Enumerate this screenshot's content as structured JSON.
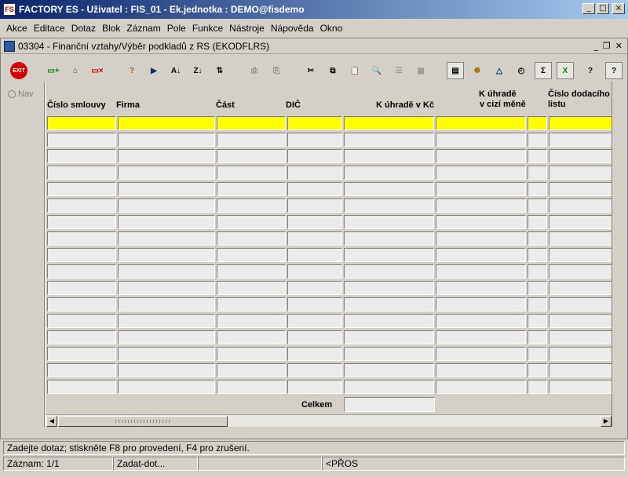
{
  "window": {
    "title": "FACTORY ES - Uživatel : FIS_01 - Ek.jednotka : DEMO@fisdemo",
    "app_icon": "FS"
  },
  "menu": [
    "Akce",
    "Editace",
    "Dotaz",
    "Blok",
    "Záznam",
    "Pole",
    "Funkce",
    "Nástroje",
    "Nápověda",
    "Okno"
  ],
  "form": {
    "title": "03304 - Finanční vztahy/Výběr podkladů z RS (EKODFLRS)"
  },
  "toolbar": {
    "exit_label": "EXIT",
    "icons": [
      "exit-icon",
      "insert-record-icon",
      "save-icon",
      "delete-record-icon",
      "query-icon",
      "execute-query-icon",
      "sort-asc-icon",
      "sort-desc-icon",
      "sort-icon",
      "print-icon",
      "print-preview-icon",
      "cut-icon",
      "copy-icon",
      "paste-icon",
      "zoom-icon",
      "list-icon",
      "grid-icon",
      "calculator-icon",
      "wheel-icon",
      "triangle-icon",
      "clock-icon",
      "sum-icon",
      "excel-icon",
      "help-icon",
      "context-help-icon"
    ]
  },
  "nav": {
    "label": "Nav"
  },
  "columns": [
    {
      "label": "Číslo smlouvy"
    },
    {
      "label": "Firma"
    },
    {
      "label": "Část"
    },
    {
      "label": "DIČ"
    },
    {
      "label": "K úhradě v Kč"
    },
    {
      "label_line1": "K úhradě",
      "label_line2": "v cizí měně"
    },
    {
      "label": ""
    },
    {
      "label_line1": "Číslo dodacího",
      "label_line2": "listu"
    }
  ],
  "row_count": 17,
  "total": {
    "label": "Celkem",
    "value": ""
  },
  "status": {
    "message": "Zadejte dotaz; stiskněte F8 pro provedení, F4 pro zrušení.",
    "record": "Záznam: 1/1",
    "mode": "Zadat-dot...",
    "field3": "",
    "insert": "<PŘOS"
  },
  "colors": {
    "selected_row": "#ffff00",
    "cell_bg": "#ebebeb",
    "titlebar": "#0a246a"
  }
}
